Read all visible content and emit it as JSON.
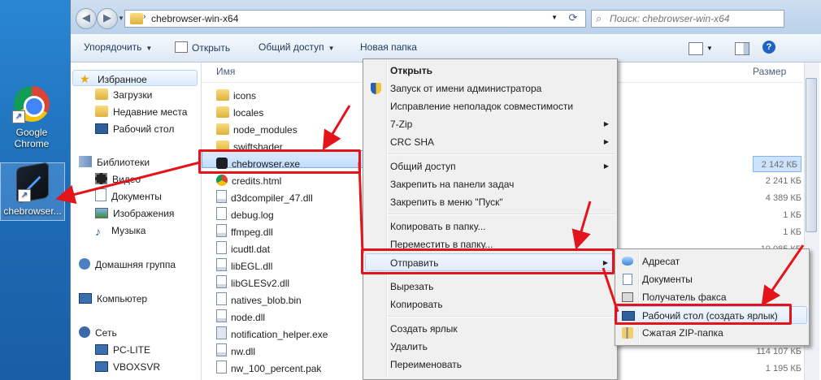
{
  "desktop": {
    "icons": [
      {
        "label": "Google\nChrome",
        "line1": "Google",
        "line2": "Chrome"
      },
      {
        "label": "chebrowser...",
        "line1": "chebrowser..."
      }
    ]
  },
  "window": {
    "address": "chebrowser-win-x64",
    "search_placeholder": "Поиск: chebrowser-win-x64",
    "toolbar": {
      "organize": "Упорядочить",
      "open": "Открыть",
      "share": "Общий доступ",
      "new_folder": "Новая папка"
    },
    "nav": {
      "favorites": "Избранное",
      "downloads": "Загрузки",
      "recent": "Недавние места",
      "desktop": "Рабочий стол",
      "libraries": "Библиотеки",
      "video": "Видео",
      "documents": "Документы",
      "images": "Изображения",
      "music": "Музыка",
      "homegroup": "Домашняя группа",
      "computer": "Компьютер",
      "network": "Сеть",
      "pc1": "PC-LITE",
      "pc2": "VBOXSVR"
    },
    "columns": {
      "name": "Имя",
      "size": "Размер"
    },
    "files": [
      {
        "name": "icons",
        "type": "folder",
        "size": ""
      },
      {
        "name": "locales",
        "type": "folder",
        "size": ""
      },
      {
        "name": "node_modules",
        "type": "folder",
        "size": ""
      },
      {
        "name": "swiftshader",
        "type": "folder",
        "size": ""
      },
      {
        "name": "chebrowser.exe",
        "type": "exe",
        "size": "2 142 КБ"
      },
      {
        "name": "credits.html",
        "type": "html",
        "size": "2 241 КБ"
      },
      {
        "name": "d3dcompiler_47.dll",
        "type": "dll",
        "size": "4 389 КБ"
      },
      {
        "name": "debug.log",
        "type": "file",
        "size": "1 КБ"
      },
      {
        "name": "ffmpeg.dll",
        "type": "dll",
        "size": "1 КБ"
      },
      {
        "name": "icudtl.dat",
        "type": "file",
        "size": "10 085 КБ"
      },
      {
        "name": "libEGL.dll",
        "type": "dll",
        "size": ""
      },
      {
        "name": "libGLESv2.dll",
        "type": "dll",
        "size": ""
      },
      {
        "name": "natives_blob.bin",
        "type": "file",
        "size": ""
      },
      {
        "name": "node.dll",
        "type": "dll",
        "size": ""
      },
      {
        "name": "notification_helper.exe",
        "type": "exe2",
        "size": ""
      },
      {
        "name": "nw.dll",
        "type": "dll",
        "size": "114 107 КБ"
      },
      {
        "name": "nw_100_percent.pak",
        "type": "file",
        "size": "1 195 КБ"
      }
    ]
  },
  "context_menu": {
    "items": [
      {
        "label": "Открыть",
        "bold": true
      },
      {
        "label": "Запуск от имени администратора",
        "shield": true
      },
      {
        "label": "Исправление неполадок совместимости"
      },
      {
        "label": "7-Zip",
        "submenu": true
      },
      {
        "label": "CRC SHA",
        "submenu": true
      },
      {
        "label": "Общий доступ",
        "submenu": true
      },
      {
        "label": "Закрепить на панели задач"
      },
      {
        "label": "Закрепить в меню \"Пуск\""
      },
      {
        "label": "Копировать в папку..."
      },
      {
        "label": "Переместить в папку..."
      },
      {
        "label": "Отправить",
        "submenu": true,
        "highlighted": true
      },
      {
        "label": "Вырезать"
      },
      {
        "label": "Копировать"
      },
      {
        "label": "Создать ярлык"
      },
      {
        "label": "Удалить"
      },
      {
        "label": "Переименовать"
      }
    ]
  },
  "sendto_menu": {
    "items": [
      {
        "label": "Адресат"
      },
      {
        "label": "Документы"
      },
      {
        "label": "Получатель факса"
      },
      {
        "label": "Рабочий стол (создать ярлык)",
        "highlighted": true
      },
      {
        "label": "Сжатая ZIP-папка"
      }
    ]
  },
  "colors": {
    "annotation_red": "#e4141b",
    "selection": "#cde3fb"
  }
}
